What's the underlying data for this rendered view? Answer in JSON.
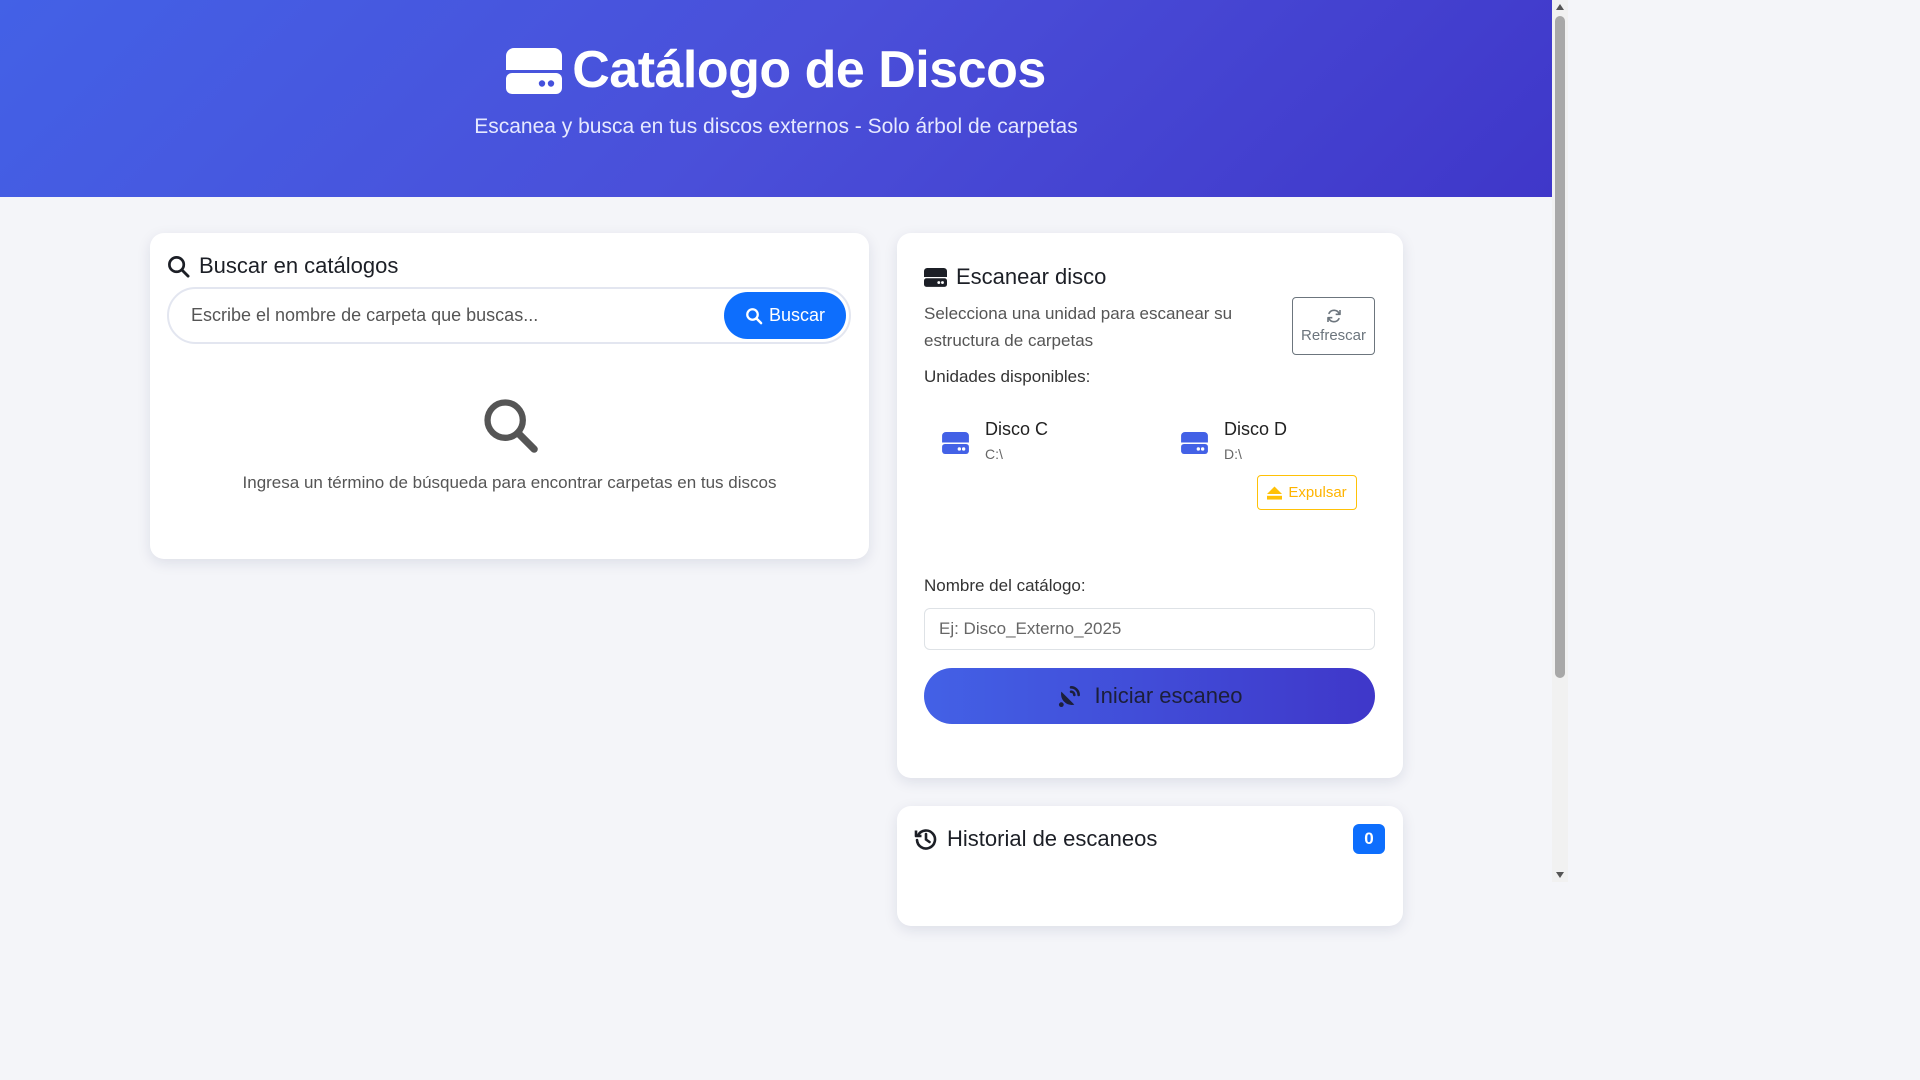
{
  "header": {
    "title": "Catálogo de Discos",
    "subtitle": "Escanea y busca en tus discos externos - Solo árbol de carpetas",
    "icon": "hdd-icon"
  },
  "search": {
    "title": "Buscar en catálogos",
    "placeholder": "Escribe el nombre de carpeta que buscas...",
    "button_label": "Buscar",
    "empty_message": "Ingresa un término de búsqueda para encontrar carpetas en tus discos"
  },
  "scan": {
    "title": "Escanear disco",
    "description": "Selecciona una unidad para escanear su estructura de carpetas",
    "refresh_label": "Refrescar",
    "units_label": "Unidades disponibles:",
    "drives": [
      {
        "name": "Disco C",
        "path": "C:\\"
      },
      {
        "name": "Disco D",
        "path": "D:\\",
        "eject_label": "Expulsar"
      }
    ],
    "catalog_label": "Nombre del catálogo:",
    "catalog_placeholder": "Ej: Disco_Externo_2025",
    "start_label": "Iniciar escaneo"
  },
  "history": {
    "title": "Historial de escaneos",
    "count": "0"
  },
  "colors": {
    "accent": "#4361e6",
    "primary_button": "#0d6efd",
    "warning": "#ffc107"
  }
}
